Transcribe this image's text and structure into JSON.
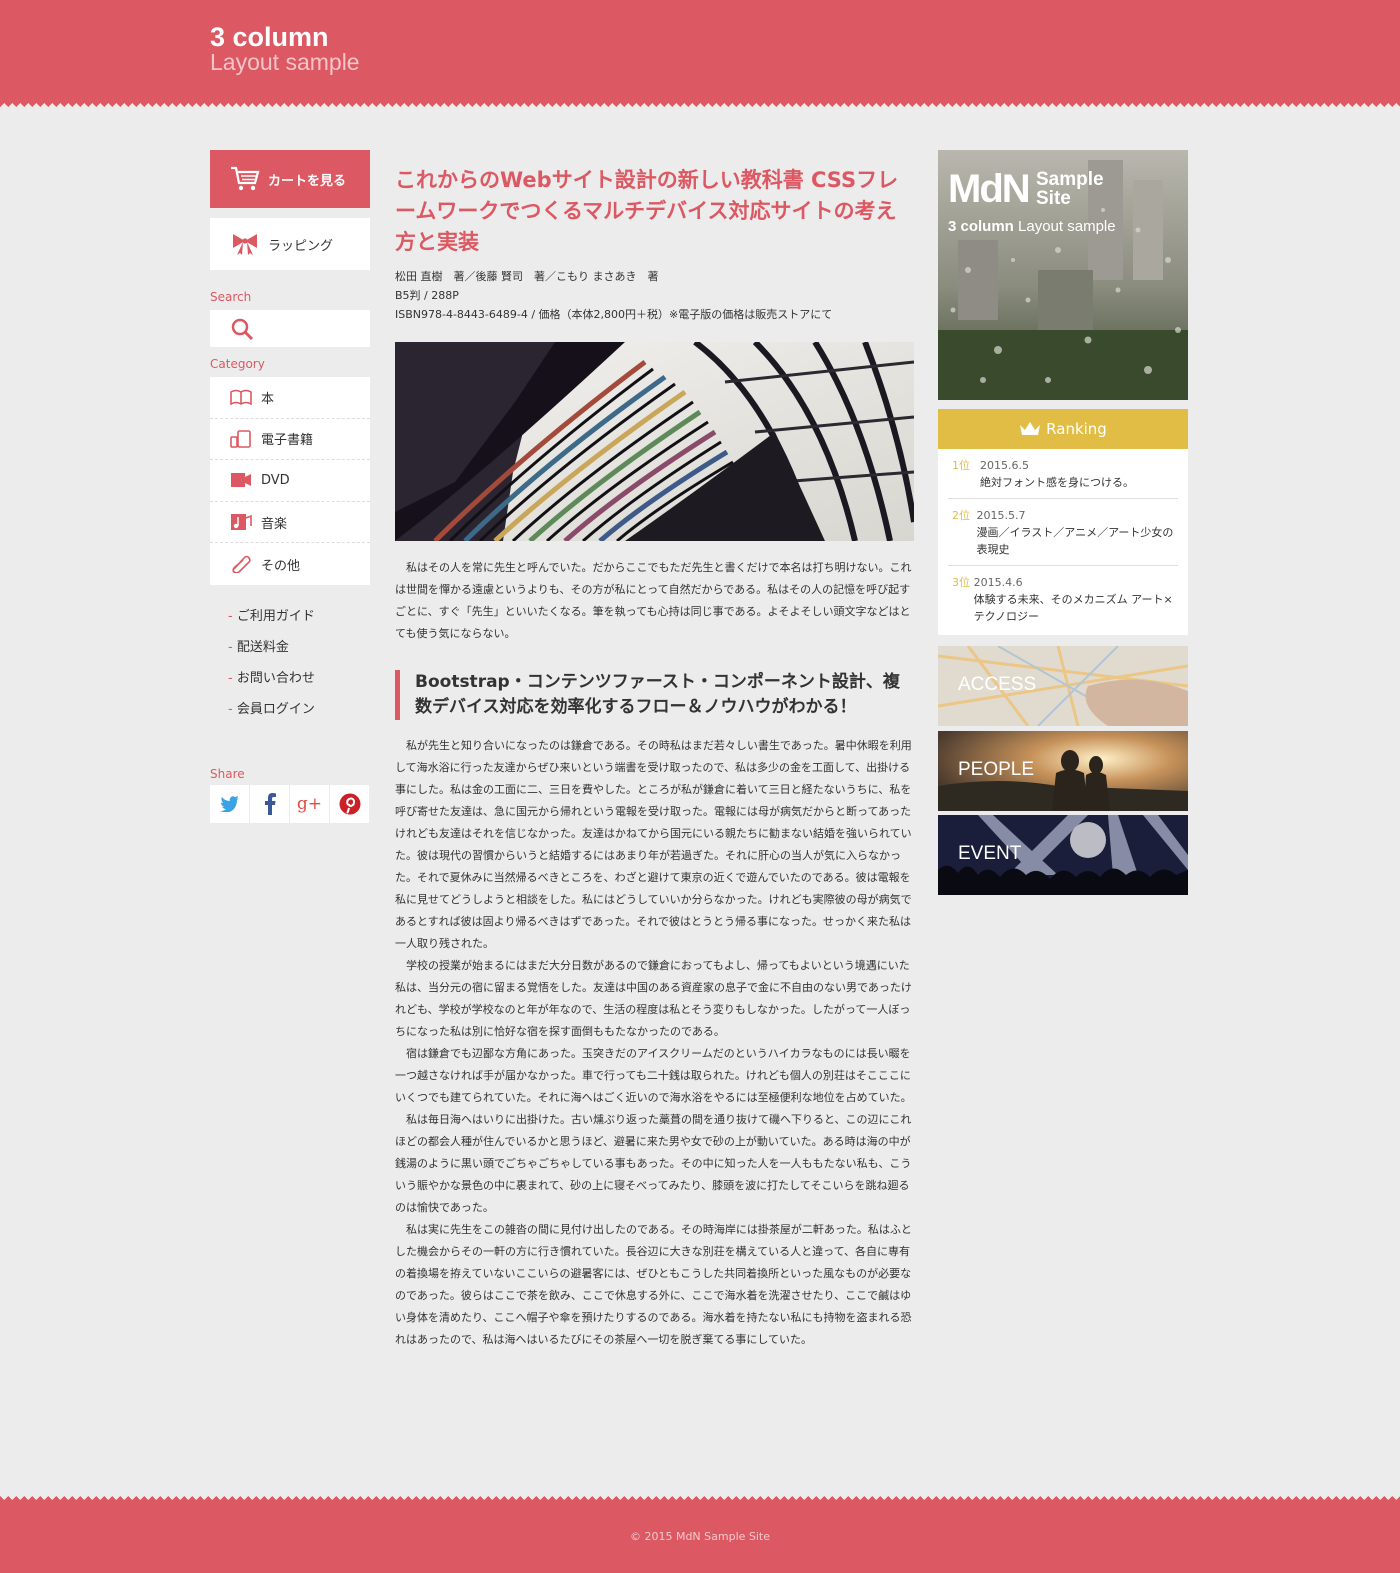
{
  "header": {
    "title": "3 column",
    "subtitle": "Layout sample"
  },
  "left": {
    "cart_label": "カートを見る",
    "wrap_label": "ラッピング",
    "search_label": "Search",
    "category_label": "Category",
    "categories": [
      {
        "label": "本",
        "icon": "book-icon"
      },
      {
        "label": "電子書籍",
        "icon": "tablet-icon"
      },
      {
        "label": "DVD",
        "icon": "dvd-icon"
      },
      {
        "label": "音楽",
        "icon": "music-icon"
      },
      {
        "label": "その他",
        "icon": "paperclip-icon"
      }
    ],
    "links": [
      "ご利用ガイド",
      "配送料金",
      "お問い合わせ",
      "会員ログイン"
    ],
    "share_label": "Share"
  },
  "main": {
    "title": "これからのWebサイト設計の新しい教科書 CSSフレームワークでつくるマルチデバイス対応サイトの考え方と実装",
    "authors": "松田 直樹　著／後藤 賢司　著／こもり まさあき　著",
    "format": "B5判 / 288P",
    "isbn": "ISBN978-4-8443-6489-4 / 価格（本体2,800円＋税）※電子版の価格は販売ストアにて",
    "intro": "私はその人を常に先生と呼んでいた。だからここでもただ先生と書くだけで本名は打ち明けない。これは世間を憚かる遠慮というよりも、その方が私にとって自然だからである。私はその人の記憶を呼び起すごとに、すぐ「先生」といいたくなる。筆を執っても心持は同じ事である。よそよそしい頭文字などはとても使う気にならない。",
    "subhead": "Bootstrap・コンテンツファースト・コンポーネント設計、複数デバイス対応を効率化するフロー＆ノウハウがわかる！",
    "paragraphs": [
      "私が先生と知り合いになったのは鎌倉である。その時私はまだ若々しい書生であった。暑中休暇を利用して海水浴に行った友達からぜひ来いという端書を受け取ったので、私は多少の金を工面して、出掛ける事にした。私は金の工面に二、三日を費やした。ところが私が鎌倉に着いて三日と経たないうちに、私を呼び寄せた友達は、急に国元から帰れという電報を受け取った。電報には母が病気だからと断ってあったけれども友達はそれを信じなかった。友達はかねてから国元にいる親たちに勧まない結婚を強いられていた。彼は現代の習慣からいうと結婚するにはあまり年が若過ぎた。それに肝心の当人が気に入らなかった。それで夏休みに当然帰るべきところを、わざと避けて東京の近くで遊んでいたのである。彼は電報を私に見せてどうしようと相談をした。私にはどうしていいか分らなかった。けれども実際彼の母が病気であるとすれば彼は固より帰るべきはずであった。それで彼はとうとう帰る事になった。せっかく来た私は一人取り残された。",
      "学校の授業が始まるにはまだ大分日数があるので鎌倉におってもよし、帰ってもよいという境遇にいた私は、当分元の宿に留まる覚悟をした。友達は中国のある資産家の息子で金に不自由のない男であったけれども、学校が学校なのと年が年なので、生活の程度は私とそう変りもしなかった。したがって一人ぼっちになった私は別に恰好な宿を探す面倒ももたなかったのである。",
      "宿は鎌倉でも辺鄙な方角にあった。玉突きだのアイスクリームだのというハイカラなものには長い畷を一つ越さなければ手が届かなかった。車で行っても二十銭は取られた。けれども個人の別荘はそこここにいくつでも建てられていた。それに海へはごく近いので海水浴をやるには至極便利な地位を占めていた。",
      "私は毎日海へはいりに出掛けた。古い燻ぶり返った藁葺の間を通り抜けて磯へ下りると、この辺にこれほどの都会人種が住んでいるかと思うほど、避暑に来た男や女で砂の上が動いていた。ある時は海の中が銭湯のように黒い頭でごちゃごちゃしている事もあった。その中に知った人を一人ももたない私も、こういう賑やかな景色の中に裹まれて、砂の上に寝そべってみたり、膝頭を波に打たしてそこいらを跳ね廻るのは愉快であった。",
      "私は実に先生をこの雑沓の間に見付け出したのである。その時海岸には掛茶屋が二軒あった。私はふとした機会からその一軒の方に行き慣れていた。長谷辺に大きな別荘を構えている人と違って、各自に専有の着換場を拵えていないここいらの避暑客には、ぜひともこうした共同着換所といった風なものが必要なのであった。彼らはここで茶を飲み、ここで休息する外に、ここで海水着を洗濯させたり、ここで鹹はゆい身体を清めたり、ここへ帽子や傘を預けたりするのである。海水着を持たない私にも持物を盗まれる恐れはあったので、私は海へはいるたびにその茶屋へ一切を脱ぎ棄てる事にしていた。"
    ]
  },
  "right": {
    "promo": {
      "logo": "MdN",
      "logo_sub": "Sample Site",
      "tag_bold": "3 column",
      "tag_rest": " Layout sample"
    },
    "ranking_title": "Ranking",
    "ranking": [
      {
        "rank": "1位",
        "date": "2015.6.5",
        "text": "絶対フォント感を身につける。"
      },
      {
        "rank": "2位",
        "date": "2015.5.7",
        "text": "漫画／イラスト／アニメ／アート少女の表現史"
      },
      {
        "rank": "3位",
        "date": "2015.4.6",
        "text": "体験する未来、そのメカニズム アート×テクノロジー"
      }
    ],
    "banners": [
      "ACCESS",
      "PEOPLE",
      "EVENT"
    ]
  },
  "footer": {
    "copyright": "© 2015 MdN Sample Site"
  },
  "colors": {
    "accent": "#dc5862",
    "gold": "#e2bd45",
    "background": "#ececec"
  }
}
